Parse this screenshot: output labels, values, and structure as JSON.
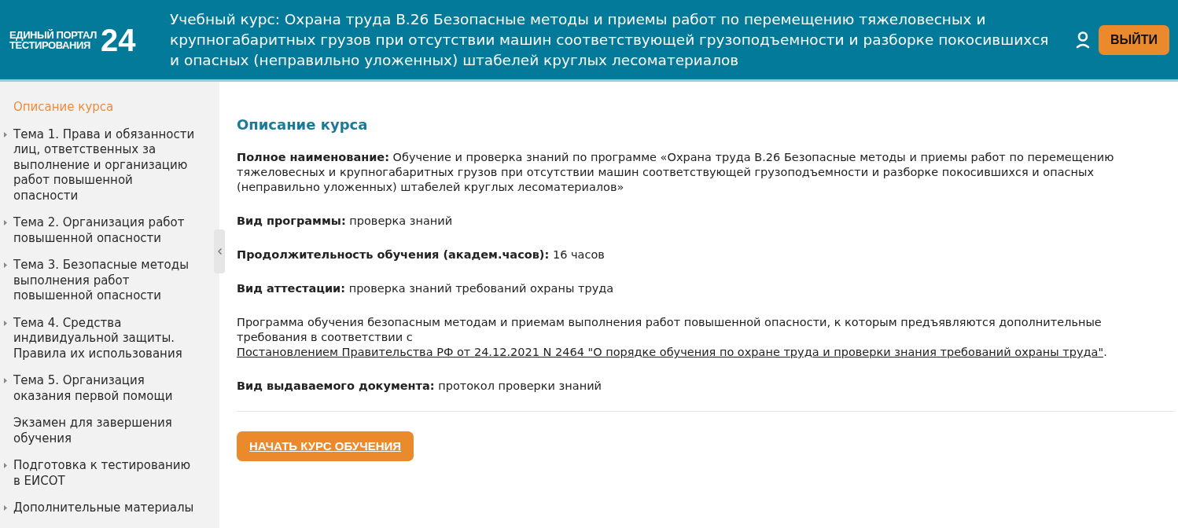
{
  "header": {
    "logo": {
      "line_1": "ЕДИНЫЙ ПОРТАЛ",
      "line_2": "ТЕСТИРОВАНИЯ",
      "number": "24"
    },
    "title": "Учебный курс: Охрана труда В.26 Безопасные методы и приемы работ по перемещению тяжеловесных и крупногабаритных грузов при отсутствии машин соответствующей грузоподъемности и разборке покосившихся и опасных (неправильно уложенных) штабелей круглых лесоматериалов",
    "logout_button": "ВЫЙТИ"
  },
  "sidebar": {
    "items": [
      {
        "label": "Описание курса",
        "kind": "link",
        "selected": true
      },
      {
        "label": "Тема 1. Права и обязанности лиц, ответственных за выполнение и организацию работ повышенной опасности",
        "kind": "group",
        "selected": false
      },
      {
        "label": "Тема 2. Организация работ повышенной опасности",
        "kind": "group",
        "selected": false
      },
      {
        "label": "Тема 3. Безопасные методы выполнения работ повышенной опасности",
        "kind": "group",
        "selected": false
      },
      {
        "label": "Тема 4. Средства индивидуальной защиты. Правила их использования",
        "kind": "group",
        "selected": false
      },
      {
        "label": "Тема 5. Организация оказания первой помощи",
        "kind": "group",
        "selected": false
      },
      {
        "label": "Экзамен для завершения обучения",
        "kind": "link",
        "selected": false
      },
      {
        "label": "Подготовка к тестированию в ЕИСОТ",
        "kind": "group",
        "selected": false
      },
      {
        "label": "Дополнительные материалы",
        "kind": "group",
        "selected": false
      }
    ]
  },
  "content": {
    "heading": "Описание курса",
    "sections": [
      {
        "kind": "field",
        "label": "Полное наименование:",
        "value": "Обучение и проверка знаний по программе «Охрана труда В.26 Безопасные методы и приемы работ по перемещению тяжеловесных и крупногабаритных грузов при отсутствии машин соответствующей грузоподъемности и разборке покосившихся и опасных (неправильно уложенных) штабелей круглых лесоматериалов»"
      },
      {
        "kind": "field",
        "label": "Вид программы:",
        "value": "проверка знаний"
      },
      {
        "kind": "field",
        "label": "Продолжительность обучения (академ.часов):",
        "value": "16 часов"
      },
      {
        "kind": "field",
        "label": "Вид аттестации:",
        "value": "проверка знаний требований охраны труда"
      },
      {
        "kind": "paragraph",
        "text": "Программа обучения безопасным методам и приемам выполнения работ повышенной опасности, к которым предъявляются дополнительные требования в соответствии с",
        "link": "Постановлением Правительства РФ от 24.12.2021 N 2464 \"О порядке обучения по охране труда и проверки знания требований охраны труда\"",
        "after": "."
      },
      {
        "kind": "field",
        "label": "Вид выдаваемого документа:",
        "value": "протокол проверки знаний"
      }
    ],
    "start_button": "НАЧАТЬ КУРС ОБУЧЕНИЯ"
  }
}
